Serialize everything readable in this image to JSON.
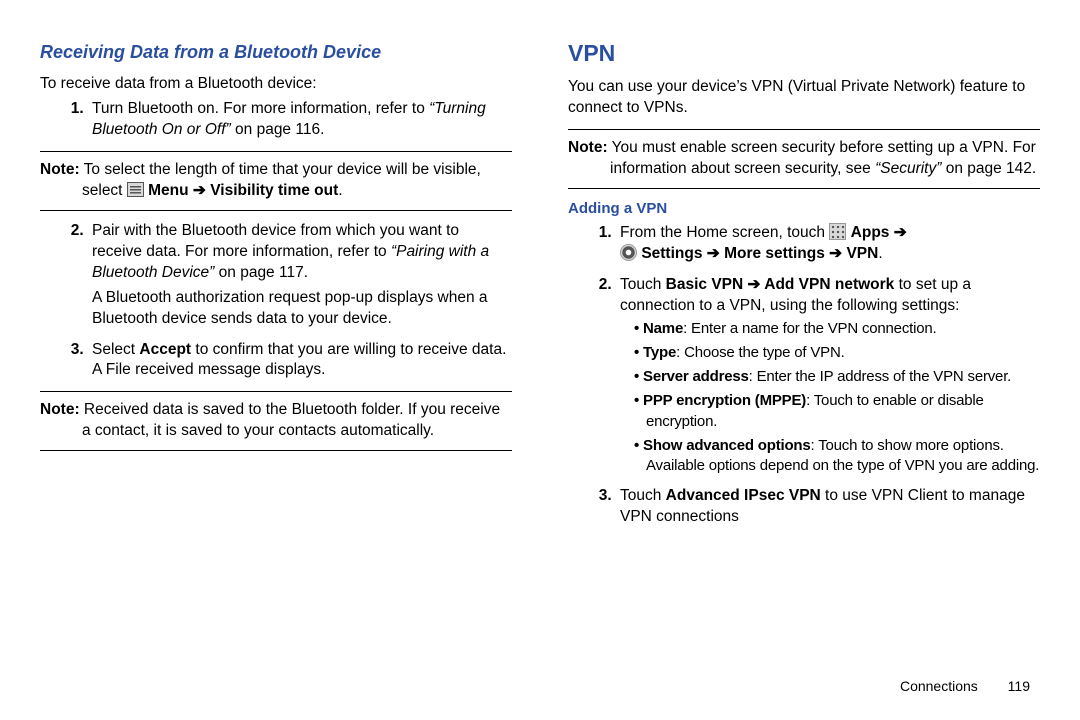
{
  "left": {
    "heading": "Receiving Data from a Bluetooth Device",
    "intro": "To receive data from a Bluetooth device:",
    "step1_a": "Turn Bluetooth on. For more information, refer to ",
    "step1_ref": "“Turning Bluetooth On or Off”",
    "step1_b": "  on page 116.",
    "note1_label": "Note:",
    "note1_a": " To select the length of time that your device will be visible, select ",
    "note1_menu": "Menu",
    "note1_arrow": " ➔ ",
    "note1_b": "Visibility time out",
    "note1_c": ".",
    "step2_a": "Pair with the Bluetooth device from which you want to receive data. For more information, refer to ",
    "step2_ref": "“Pairing with a Bluetooth Device”",
    "step2_b": "  on page 117.",
    "step2_p2": "A Bluetooth authorization request pop-up displays when a Bluetooth device sends data to your device.",
    "step3_a": "Select ",
    "step3_accept": "Accept",
    "step3_b": " to confirm that you are willing to receive data. A File received message displays.",
    "note2_label": "Note:",
    "note2_body": " Received data is saved to the Bluetooth folder. If you receive a contact, it is saved to your contacts automatically."
  },
  "right": {
    "heading": "VPN",
    "intro": "You can use your device’s VPN (Virtual Private Network) feature to connect to VPNs.",
    "note_label": "Note:",
    "note_a": " You must enable screen security before setting up a VPN. For information about screen security, see ",
    "note_ref": "“Security”",
    "note_b": " on page 142.",
    "sub": "Adding a VPN",
    "s1_a": "From the Home screen, touch ",
    "s1_apps": "Apps",
    "s1_arr": " ➔ ",
    "s1_settings": "Settings",
    "s1_more": "More settings",
    "s1_vpn": "VPN",
    "s1_dot": ".",
    "s2_a": "Touch ",
    "s2_b1": "Basic VPN",
    "s2_arr": " ➔ ",
    "s2_b2": "Add VPN network",
    "s2_c": " to set up a connection to a VPN, using the following settings:",
    "bullets": {
      "b1_k": "Name",
      "b1_v": ": Enter a name for the VPN connection.",
      "b2_k": "Type",
      "b2_v": ": Choose the type of VPN.",
      "b3_k": "Server address",
      "b3_v": ": Enter the IP address of the VPN server.",
      "b4_k": "PPP encryption (MPPE)",
      "b4_v": ": Touch to enable or disable encryption.",
      "b5_k": "Show advanced options",
      "b5_v": ": Touch to show more options. Available options depend on the type of VPN you are adding."
    },
    "s3_a": "Touch ",
    "s3_b": "Advanced IPsec VPN",
    "s3_c": " to use VPN Client to manage VPN connections"
  },
  "footer": {
    "section": "Connections",
    "page": "119"
  }
}
